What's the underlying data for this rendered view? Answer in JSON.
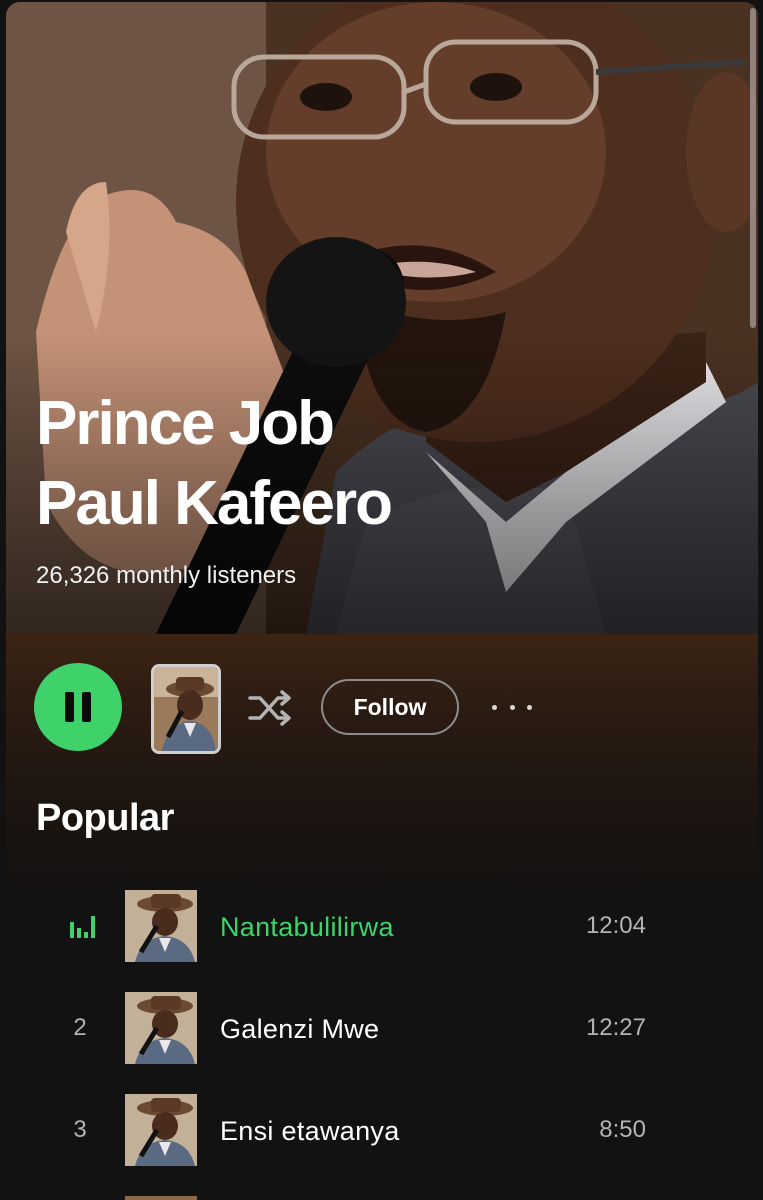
{
  "artist": {
    "name_line1": "Prince Job",
    "name_line2": "Paul Kafeero",
    "monthly_listeners": "26,326 monthly listeners"
  },
  "actions": {
    "play_state": "pause-icon",
    "shuffle_icon": "shuffle-icon",
    "follow_label": "Follow",
    "more_icon": "more-options-icon"
  },
  "popular": {
    "title": "Popular",
    "tracks": [
      {
        "index": "",
        "title": "Nantabulilirwa",
        "duration": "12:04",
        "playing": true,
        "indicator_icon": "equalizer-icon"
      },
      {
        "index": "2",
        "title": "Galenzi Mwe",
        "duration": "12:27",
        "playing": false
      },
      {
        "index": "3",
        "title": "Ensi etawanya",
        "duration": "8:50",
        "playing": false
      }
    ]
  },
  "colors": {
    "accent": "#3fd26b",
    "header_bg": "#3c2414",
    "page_bg": "#121212",
    "muted_text": "#b3b3b3"
  }
}
